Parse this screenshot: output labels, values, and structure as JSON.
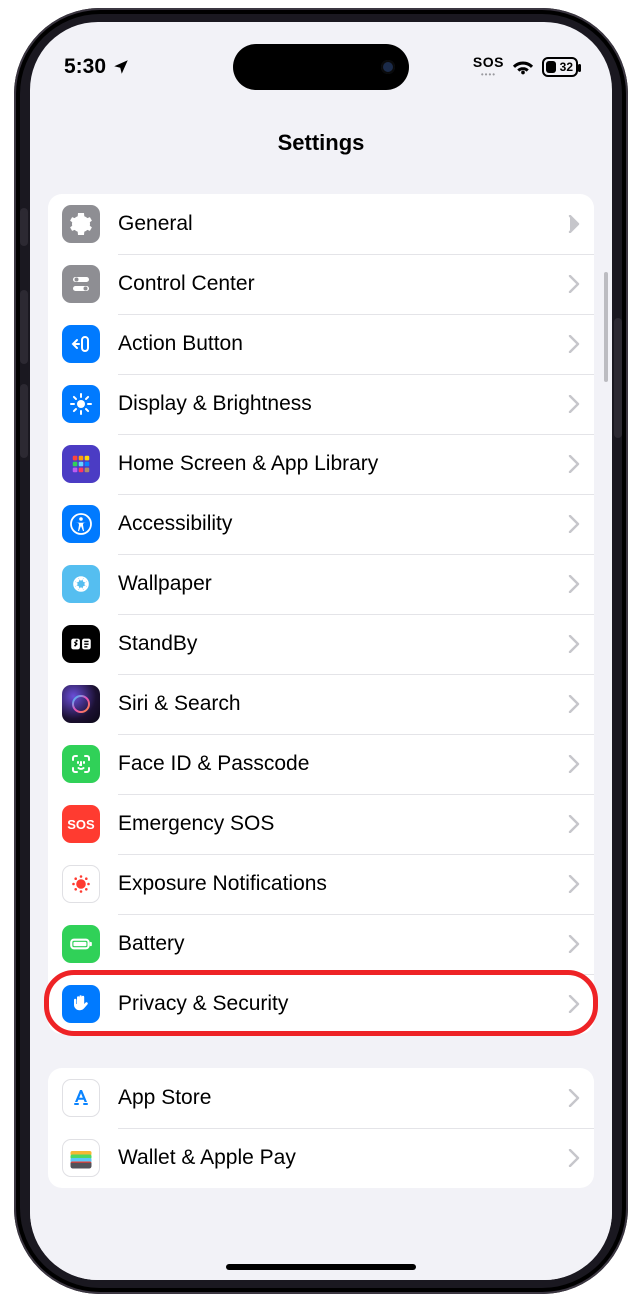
{
  "status": {
    "time": "5:30",
    "sos": "SOS",
    "battery_pct": "32"
  },
  "nav": {
    "title": "Settings"
  },
  "items": {
    "general": "General",
    "control_center": "Control Center",
    "action_button": "Action Button",
    "display": "Display & Brightness",
    "home_screen": "Home Screen & App Library",
    "accessibility": "Accessibility",
    "wallpaper": "Wallpaper",
    "standby": "StandBy",
    "siri": "Siri & Search",
    "faceid": "Face ID & Passcode",
    "sos": "Emergency SOS",
    "exposure": "Exposure Notifications",
    "battery": "Battery",
    "privacy": "Privacy & Security",
    "app_store": "App Store",
    "wallet": "Wallet & Apple Pay"
  },
  "icon_labels": {
    "sos_badge": "SOS"
  }
}
